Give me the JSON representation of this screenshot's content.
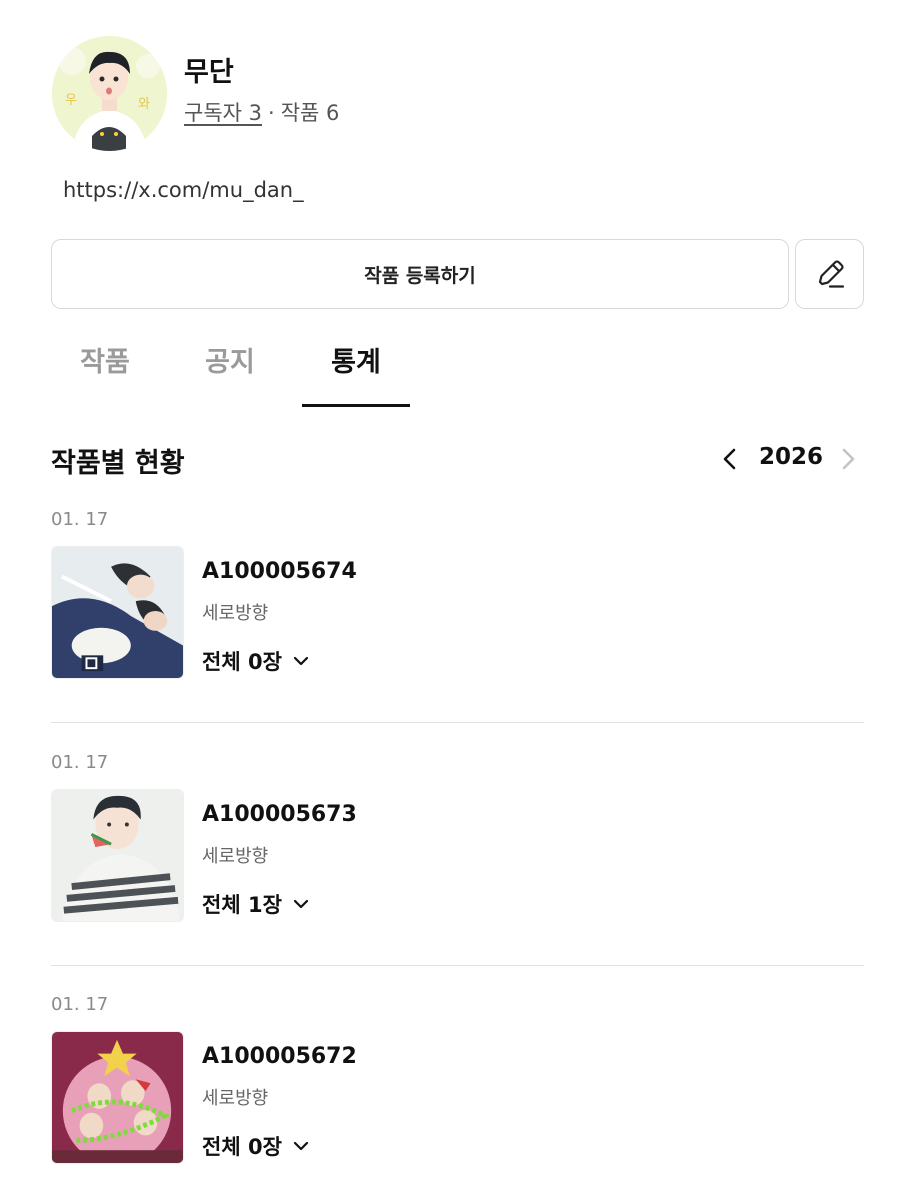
{
  "profile": {
    "name": "무단",
    "subscribers_label": "구독자 3",
    "separator": "·",
    "works_label": "작품 6",
    "link": "https://x.com/mu_dan_"
  },
  "actions": {
    "register_label": "작품 등록하기",
    "edit_icon": "pencil-icon"
  },
  "tabs": [
    {
      "label": "작품",
      "active": false
    },
    {
      "label": "공지",
      "active": false
    },
    {
      "label": "통계",
      "active": true
    }
  ],
  "section": {
    "title": "작품별 현황",
    "year": "2026",
    "prev_icon": "chevron-left-icon",
    "next_icon": "chevron-right-icon"
  },
  "entries": [
    {
      "date": "01. 17",
      "id": "A100005674",
      "orientation": "세로방향",
      "total": "전체 0장"
    },
    {
      "date": "01. 17",
      "id": "A100005673",
      "orientation": "세로방향",
      "total": "전체 1장"
    },
    {
      "date": "01. 17",
      "id": "A100005672",
      "orientation": "세로방향",
      "total": "전체 0장"
    }
  ],
  "colors": {
    "accent": "#111111",
    "muted": "#9a9a9a",
    "border": "#d9d9d9"
  }
}
